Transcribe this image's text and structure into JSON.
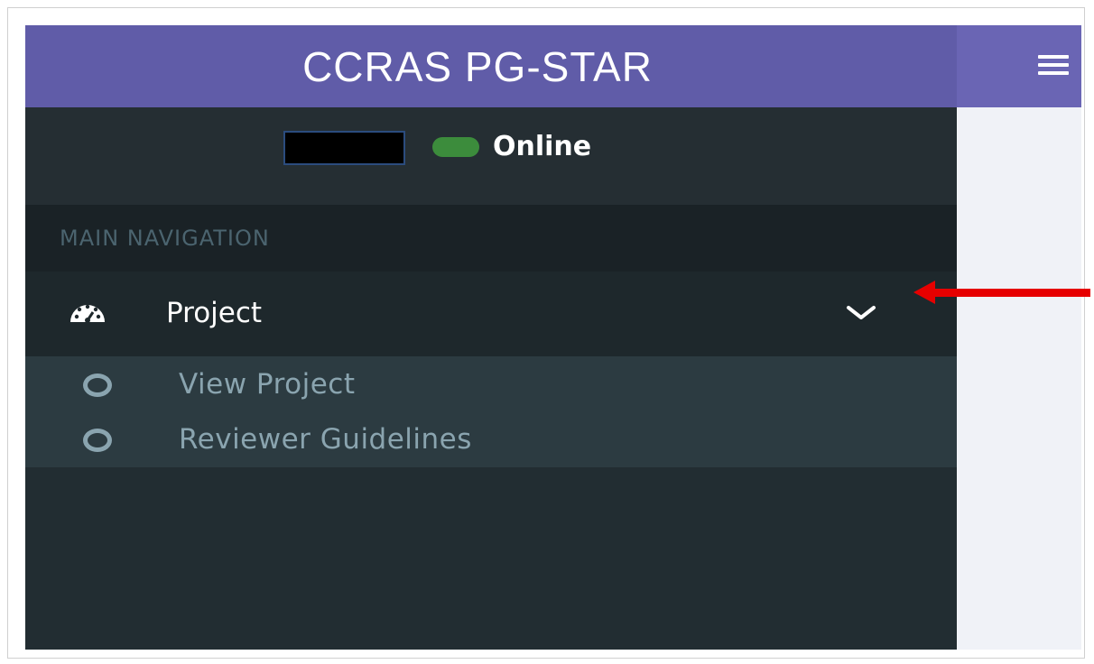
{
  "header": {
    "logo_text": "CCRAS PG-STAR",
    "menu_toggle_icon": "hamburger-icon"
  },
  "user_panel": {
    "status_text": "Online",
    "status_color": "#3c8c3c"
  },
  "sidebar": {
    "section_header": "MAIN NAVIGATION",
    "menu": {
      "label": "Project",
      "icon": "dashboard-icon",
      "expand_icon": "chevron-down-icon",
      "submenu": [
        {
          "label": "View Project",
          "icon": "circle-icon"
        },
        {
          "label": "Reviewer Guidelines",
          "icon": "circle-icon"
        }
      ]
    }
  },
  "annotation": {
    "arrow_color": "#e60000",
    "arrow_icon": "left-arrow-icon"
  },
  "colors": {
    "brand": "#605ca8",
    "sidebar_bg": "#222d32",
    "submenu_bg": "#2c3b41"
  }
}
